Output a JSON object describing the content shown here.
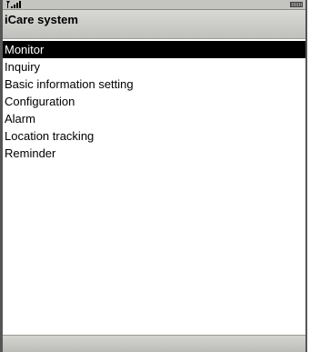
{
  "status_bar": {
    "signal_icon": "signal-strength-icon",
    "battery_icon": "battery-icon"
  },
  "title": "iCare system",
  "menu": {
    "items": [
      {
        "label": "Monitor",
        "selected": true
      },
      {
        "label": "Inquiry",
        "selected": false
      },
      {
        "label": "Basic information setting",
        "selected": false
      },
      {
        "label": "Configuration",
        "selected": false
      },
      {
        "label": "Alarm",
        "selected": false
      },
      {
        "label": "Location tracking",
        "selected": false
      },
      {
        "label": "Reminder",
        "selected": false
      }
    ]
  },
  "colors": {
    "selection_background": "#000000",
    "selection_text": "#ffffff",
    "bar_background": "#c8c8c4"
  }
}
